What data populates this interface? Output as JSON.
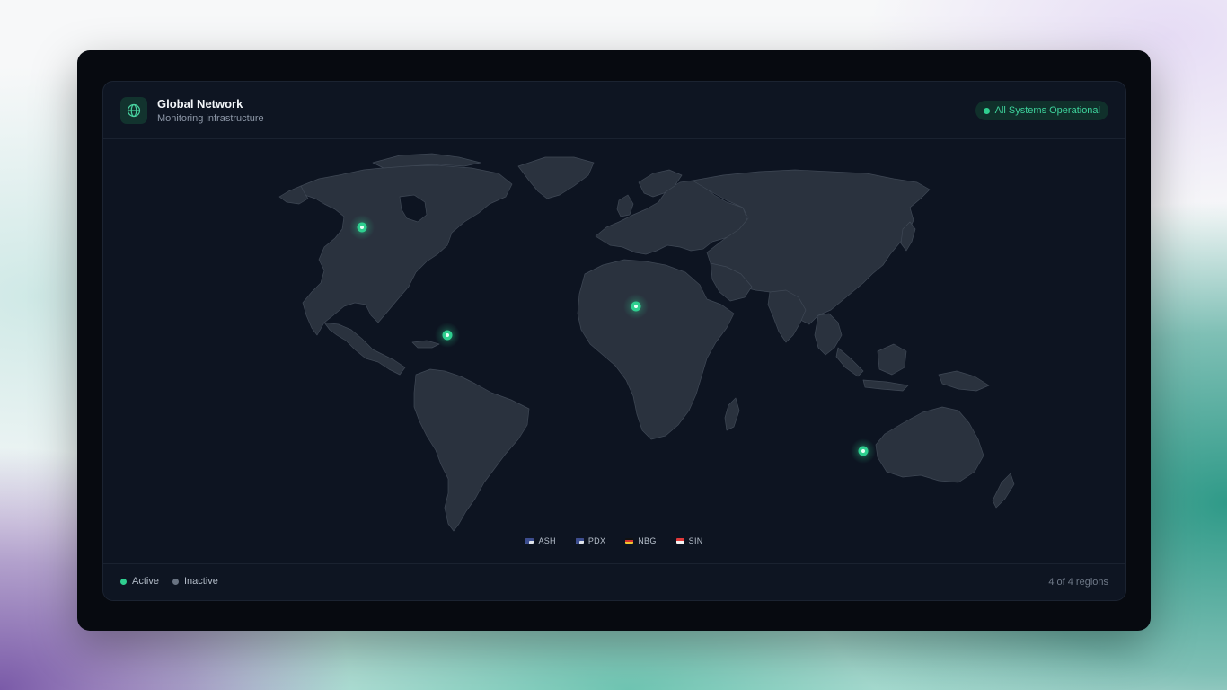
{
  "header": {
    "title": "Global Network",
    "subtitle": "Monitoring infrastructure",
    "status": "All Systems Operational",
    "icon": "globe-icon"
  },
  "map": {
    "land_color": "#2a323e",
    "border_color": "#3f4855",
    "ocean_color": "#0d1421",
    "active_color": "#2fce8f",
    "servers": [
      {
        "code": "ASH",
        "country": "US",
        "status": "active"
      },
      {
        "code": "PDX",
        "country": "US",
        "status": "active"
      },
      {
        "code": "NBG",
        "country": "DE",
        "status": "active"
      },
      {
        "code": "SIN",
        "country": "SG",
        "status": "active"
      }
    ]
  },
  "regions": [
    {
      "code": "ASH",
      "flag": "us"
    },
    {
      "code": "PDX",
      "flag": "us"
    },
    {
      "code": "NBG",
      "flag": "de"
    },
    {
      "code": "SIN",
      "flag": "sg"
    }
  ],
  "footer": {
    "legend_active": "Active",
    "legend_inactive": "Inactive",
    "region_count": "4 of 4 regions"
  },
  "colors": {
    "accent": "#2fce8f",
    "inactive": "#697382",
    "card": "#0e1522"
  }
}
